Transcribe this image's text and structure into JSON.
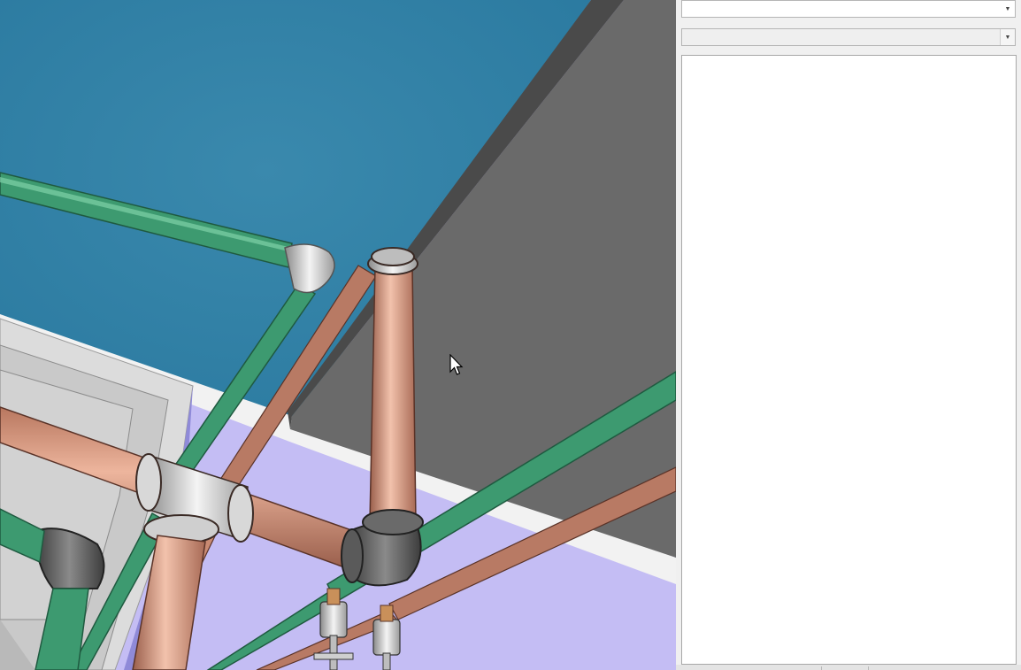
{
  "viewport": {
    "colors": {
      "sky": "#2e7ea3",
      "floor": "#c4bdf4",
      "wall": "#6b6b6b",
      "copper_pipe": "#c98a72",
      "green_pipe": "#3e9a72",
      "fitting": "#cfcfcf",
      "dark_fitting": "#5a5a5a"
    },
    "cursor_icon": "arrow-pointer"
  },
  "panel": {
    "type_selector": {
      "value": ""
    },
    "instance_selector": {
      "value": "",
      "disabled": true
    },
    "properties": {
      "rows": []
    }
  }
}
